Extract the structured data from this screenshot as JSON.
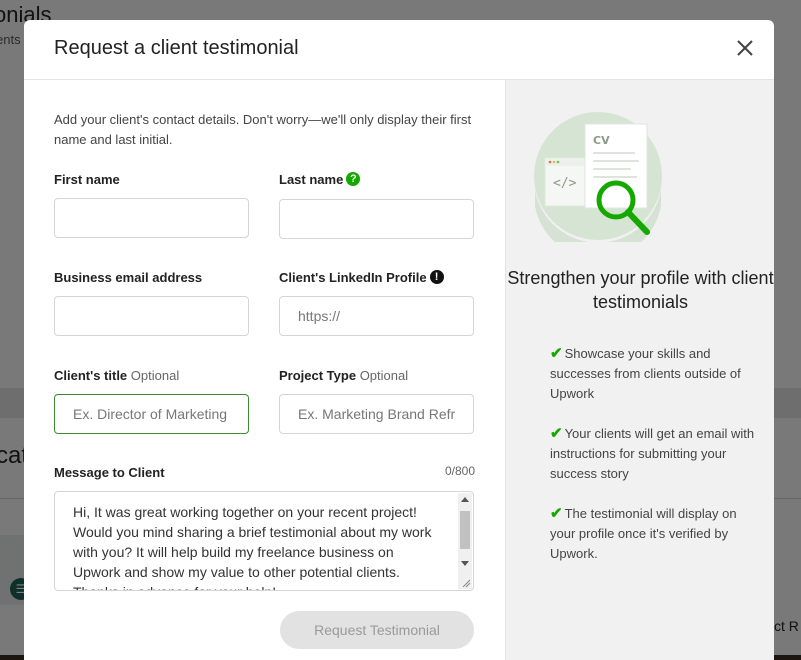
{
  "background": {
    "title": "onials",
    "subtitle": "ents",
    "section_partial": "cat",
    "right_partial": "ct R"
  },
  "modal": {
    "title": "Request a client testimonial",
    "intro": "Add your client's contact details. Don't worry—we'll only display their first name and last initial.",
    "fields": {
      "first_name": {
        "label": "First name",
        "value": "",
        "placeholder": ""
      },
      "last_name": {
        "label": "Last name",
        "value": "",
        "placeholder": ""
      },
      "email": {
        "label": "Business email address",
        "value": "",
        "placeholder": ""
      },
      "linkedin": {
        "label": "Client's LinkedIn Profile",
        "value": "",
        "placeholder": "https://"
      },
      "client_title": {
        "label": "Client's title",
        "optional": "Optional",
        "value": "",
        "placeholder": "Ex. Director of Marketing"
      },
      "project_type": {
        "label": "Project Type",
        "optional": "Optional",
        "value": "",
        "placeholder": "Ex. Marketing Brand Refresh"
      },
      "message": {
        "label": "Message to Client",
        "counter": "0/800",
        "value": "Hi, It was great working together on your recent project! Would you mind sharing a brief testimonial about my work with you? It will help build my freelance business on Upwork and show my value to other potential clients. Thanks in advance for your help!"
      }
    },
    "submit_label": "Request Testimonial",
    "side": {
      "cv_label": "CV",
      "heading": "Strengthen your profile with client testimonials",
      "benefits": [
        "Showcase your skills and successes from clients outside of Upwork",
        "Your clients will get an email with instructions for submitting your success story",
        "The testimonial will display on your profile once it's verified by Upwork."
      ]
    }
  },
  "colors": {
    "accent_green": "#14a800",
    "focus_border": "#3c8a2e",
    "disabled_button": "#e2e2e2"
  }
}
